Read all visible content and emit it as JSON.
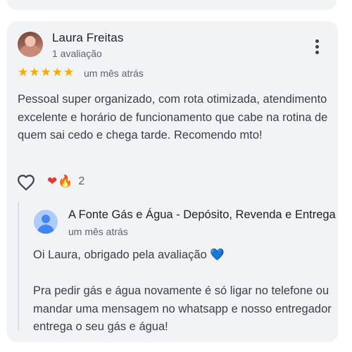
{
  "review": {
    "reviewer_name": "Laura Freitas",
    "reviewer_count": "1 avaliação",
    "rating": 5,
    "stars": [
      "★",
      "★",
      "★",
      "★",
      "★"
    ],
    "date": "um mês atrás",
    "text": "Pessoal super organizado, com rota otimizada, atendimento excelente e horário de funcionamento que cabe na rotina de quem sai cedo e chega tarde. Recomendo mto!",
    "reactions": {
      "heart_emoji": "❤",
      "fire_emoji": "🔥",
      "count": "2"
    }
  },
  "owner_reply": {
    "name": "A Fonte Gás e Água - Depósito, Revenda e Entrega de",
    "date": "um mês atrás",
    "text_line1": "Oi Laura, obrigado pela avaliação ",
    "emoji": "💙",
    "text_rest": "Pra pedir gás e água novamente é só ligar no telefone ou mandar uma mensagem no whatsapp e nosso entregador entrega o seu gás e água!"
  },
  "colors": {
    "card_background": "#f1f3f4",
    "star": "#f9ab00",
    "secondary_text": "#5f6368"
  },
  "icons": {
    "more": "more-vertical-icon",
    "like": "heart-outline-icon",
    "owner_avatar": "default-profile-icon"
  }
}
